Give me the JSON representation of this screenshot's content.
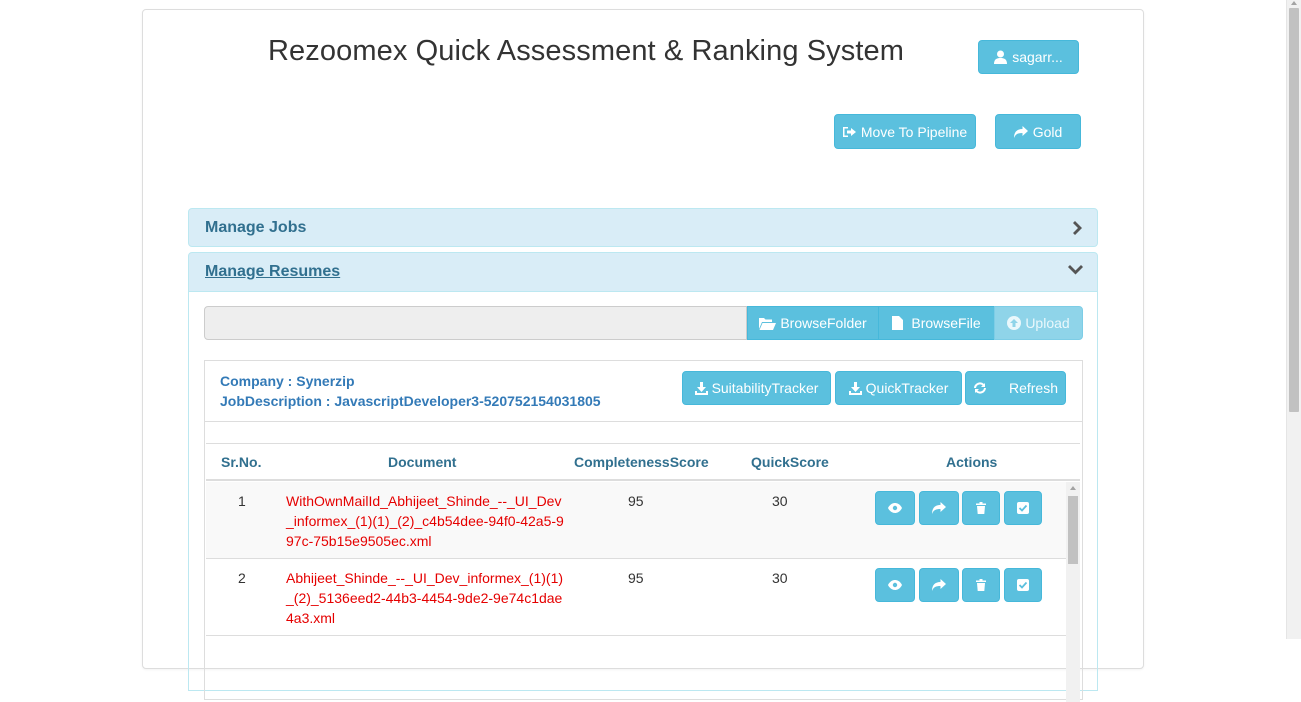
{
  "header": {
    "title": "Rezoomex Quick Assessment & Ranking System",
    "user_label": "sagarr...",
    "move_to_pipeline_label": "Move To Pipeline",
    "gold_label": "Gold"
  },
  "panels": {
    "manage_jobs": "Manage Jobs",
    "manage_resumes": "Manage Resumes"
  },
  "upload_bar": {
    "browse_folder_label": "BrowseFolder",
    "browse_file_label": "BrowseFile",
    "upload_label": "Upload"
  },
  "job_info": {
    "company": "Company : Synerzip",
    "job_description": "JobDescription : JavascriptDeveloper3-520752154031805"
  },
  "trackers": {
    "suitability_label": "SuitabilityTracker",
    "quick_label": "QuickTracker",
    "refresh_label": "Refresh"
  },
  "table": {
    "headers": [
      "Sr.No.",
      "Document",
      "CompletenessScore",
      "QuickScore",
      "Actions"
    ],
    "rows": [
      {
        "sr": "1",
        "document": "WithOwnMailId_Abhijeet_Shinde_--_UI_Dev_informex_(1)(1)_(2)_c4b54dee-94f0-42a5-997c-75b15e9505ec.xml",
        "completeness": "95",
        "quick": "30"
      },
      {
        "sr": "2",
        "document": "Abhijeet_Shinde_--_UI_Dev_informex_(1)(1)_(2)_5136eed2-44b3-4454-9de2-9e74c1dae4a3.xml",
        "completeness": "95",
        "quick": "30"
      }
    ],
    "action_icons": [
      "eye-icon",
      "share-icon",
      "trash-icon",
      "check-square-icon"
    ]
  },
  "colors": {
    "info": "#5bc0de",
    "panel_heading_bg": "#d9edf7",
    "panel_heading_text": "#31708f",
    "link_blue": "#337ab7",
    "document_red": "#e50000"
  }
}
